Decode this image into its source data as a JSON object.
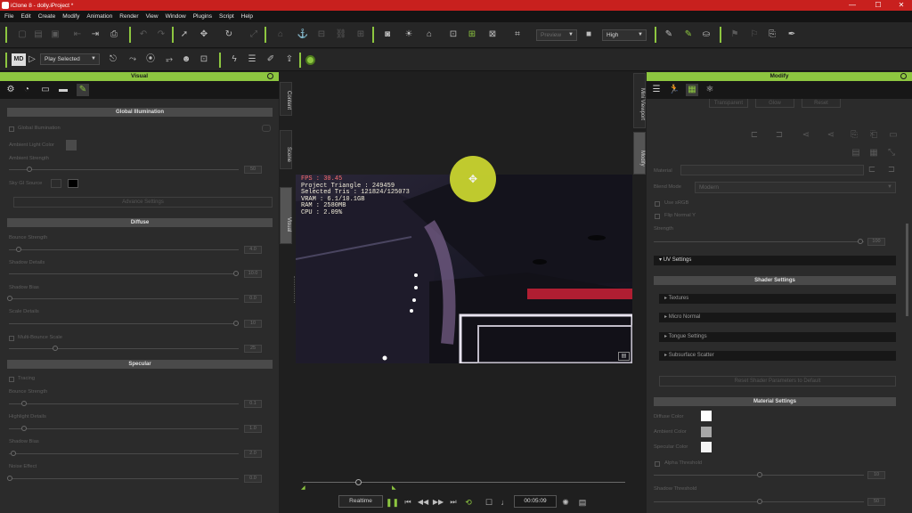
{
  "window": {
    "title": "iClone 8 - dolly.iProject *",
    "minimize": "—",
    "maximize": "☐",
    "close": "✕"
  },
  "menu": [
    "File",
    "Edit",
    "Create",
    "Modify",
    "Animation",
    "Render",
    "View",
    "Window",
    "Plugins",
    "Script",
    "Help"
  ],
  "toolbar": {
    "quality_preset": "Preview",
    "quality_level": "High",
    "play_selected": "Play Selected"
  },
  "visual_panel": {
    "title": "Visual",
    "sections": {
      "gi": "Global Illumination",
      "diffuse": "Diffuse",
      "specular": "Specular"
    },
    "gi": {
      "global_illumination": "Global Illumination",
      "ambient_light_color": "Ambient Light Color",
      "ambient_strength": "Ambient Strength",
      "ambient_strength_val": "50",
      "sky_gi_source": "Sky GI Source",
      "advance_settings": "Advance Settings"
    },
    "diffuse": {
      "bounce_strength": "Bounce Strength",
      "bounce_strength_val": "4.0",
      "shadow_details": "Shadow Details",
      "shadow_details_val": "10.0",
      "shadow_bias": "Shadow Bias",
      "shadow_bias_val": "0.0",
      "scale_details": "Scale Details",
      "scale_details_val": "10",
      "multibounce": "Multi-Bounce Scale",
      "multibounce_val": "25"
    },
    "specular": {
      "tracing": "Tracing",
      "bounce_strength": "Bounce Strength",
      "bounce_strength_val": "0.1",
      "highlight_details": "Highlight Details",
      "highlight_details_val": "1.0",
      "shadow_bias": "Shadow Bias",
      "shadow_bias_val": "2.0",
      "noise_effect": "Noise Effect",
      "noise_effect_val": "0.0"
    }
  },
  "side_tabs_left": [
    "Content",
    "Scene",
    "Visual"
  ],
  "side_tabs_right": [
    "Mini Viewport",
    "Modify"
  ],
  "viewport": {
    "fps": "FPS : 30.45",
    "stats": "Project Triangle : 249459\nSelected Tris : 121824/125073\nVRAM : 6.1/10.1GB\nRAM : 2580MB\nCPU : 2.09%"
  },
  "modify_panel": {
    "title": "Modify",
    "top_buttons": [
      "Transparent",
      "Glow",
      "Reset"
    ],
    "material_label": "Material",
    "blend_mode_label": "Blend Mode",
    "blend_mode_value": "Modern",
    "use_srgb": "Use sRGB",
    "flip_normal": "Flip Normal Y",
    "strength": "Strength",
    "strength_val": "100",
    "uv_settings": "UV Settings",
    "shader_settings": "Shader Settings",
    "shader_items": [
      "Textures",
      "Micro Normal",
      "Tongue Settings",
      "Subsurface Scatter"
    ],
    "reset_shader": "Reset Shader Parameters to Default",
    "material_settings": "Material Settings",
    "diffuse_color": "Diffuse Color",
    "ambient_color": "Ambient Color",
    "specular_color": "Specular Color",
    "alpha_threshold": "Alpha Threshold",
    "alpha_threshold_val": "10",
    "shadow_threshold": "Shadow Threshold",
    "shadow_threshold_val": "50"
  },
  "playback": {
    "mode": "Realtime",
    "time": "00:05:09",
    "progress": 0.18
  },
  "colors": {
    "accent": "#8dc640",
    "titlebar": "#c8201e",
    "gizmo": "#c9d42f"
  }
}
